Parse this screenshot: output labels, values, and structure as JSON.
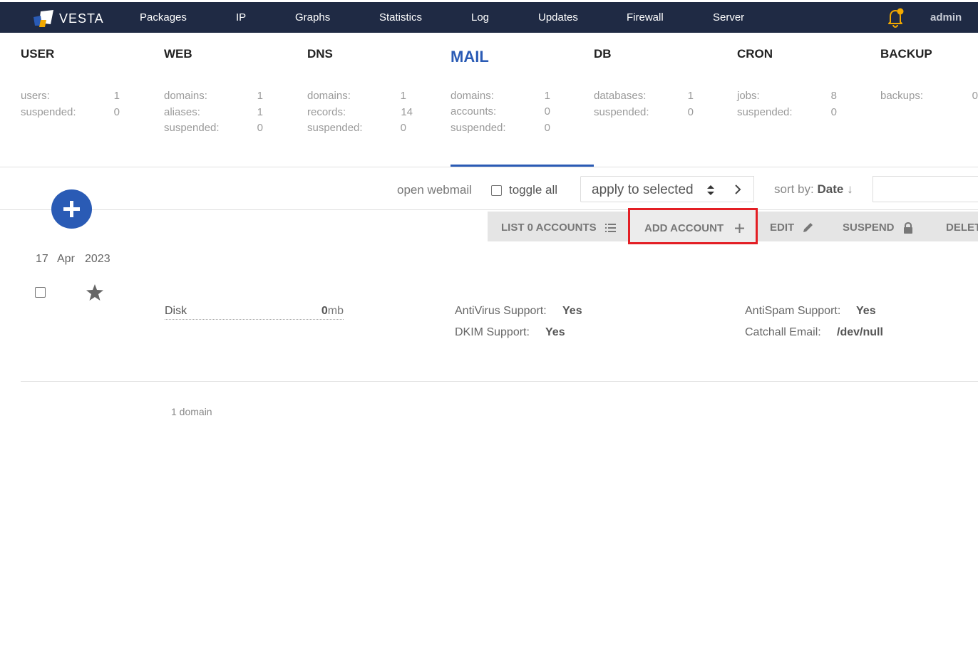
{
  "app": {
    "logo_text": "VESTA",
    "user": "admin"
  },
  "nav": [
    "Packages",
    "IP",
    "Graphs",
    "Statistics",
    "Log",
    "Updates",
    "Firewall",
    "Server"
  ],
  "stats": [
    {
      "title": "USER",
      "rows": [
        {
          "label": "users:",
          "value": "1"
        },
        {
          "label": "suspended:",
          "value": "0"
        }
      ]
    },
    {
      "title": "WEB",
      "rows": [
        {
          "label": "domains:",
          "value": "1"
        },
        {
          "label": "aliases:",
          "value": "1"
        },
        {
          "label": "suspended:",
          "value": "0"
        }
      ]
    },
    {
      "title": "DNS",
      "rows": [
        {
          "label": "domains:",
          "value": "1"
        },
        {
          "label": "records:",
          "value": "14"
        },
        {
          "label": "suspended:",
          "value": "0"
        }
      ]
    },
    {
      "title": "MAIL",
      "rows": [
        {
          "label": "domains:",
          "value": "1"
        },
        {
          "label": "accounts:",
          "value": "0"
        },
        {
          "label": "suspended:",
          "value": "0"
        }
      ]
    },
    {
      "title": "DB",
      "rows": [
        {
          "label": "databases:",
          "value": "1"
        },
        {
          "label": "suspended:",
          "value": "0"
        }
      ]
    },
    {
      "title": "CRON",
      "rows": [
        {
          "label": "jobs:",
          "value": "8"
        },
        {
          "label": "suspended:",
          "value": "0"
        }
      ]
    },
    {
      "title": "BACKUP",
      "rows": [
        {
          "label": "backups:",
          "value": "0"
        }
      ]
    }
  ],
  "toolbar": {
    "open_webmail": "open webmail",
    "toggle_all": "toggle all",
    "apply_selected": "apply to selected",
    "sort_prefix": "sort by:",
    "sort_field": "Date",
    "sort_arrow": "↓"
  },
  "actions": {
    "list": "LIST 0 ACCOUNTS",
    "add": "ADD ACCOUNT",
    "edit": "EDIT",
    "suspend": "SUSPEND",
    "delete": "DELETE"
  },
  "domain_row": {
    "date_day": "17",
    "date_month": "Apr",
    "date_year": "2023",
    "disk_label": "Disk",
    "disk_value": "0",
    "disk_unit": "mb",
    "antivirus_label": "AntiVirus Support:",
    "antivirus_value": "Yes",
    "dkim_label": "DKIM Support:",
    "dkim_value": "Yes",
    "antispam_label": "AntiSpam Support:",
    "antispam_value": "Yes",
    "catchall_label": "Catchall Email:",
    "catchall_value": "/dev/null"
  },
  "footer": {
    "count": "1 domain"
  },
  "colors": {
    "topbar": "#1f2a44",
    "accent": "#2a5bb5",
    "highlight": "#e31e24",
    "bell": "#f2a900"
  }
}
